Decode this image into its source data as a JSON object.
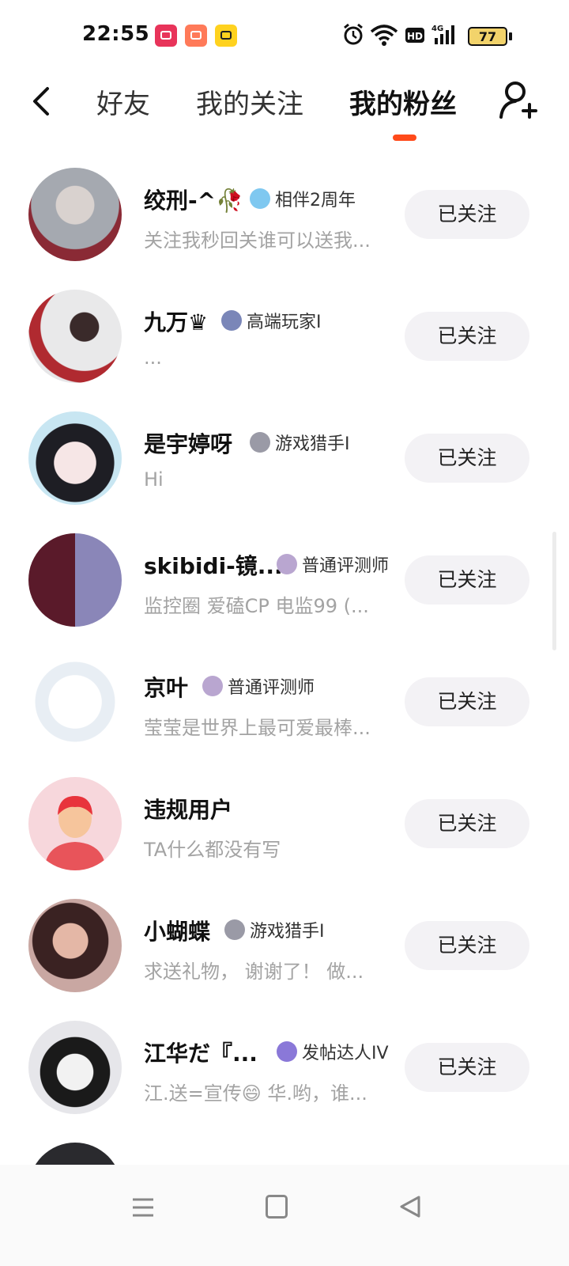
{
  "status_bar": {
    "time": "22:55",
    "battery_level": "77",
    "icons": [
      "video-app-icon",
      "game-app-icon",
      "tv-app-icon",
      "alarm-icon",
      "wifi-icon",
      "hd-icon",
      "4g-signal-icon",
      "battery-icon"
    ]
  },
  "nav": {
    "tabs": [
      {
        "label": "好友"
      },
      {
        "label": "我的关注"
      },
      {
        "label": "我的粉丝",
        "active": true
      }
    ],
    "accent_color": "#ff4a1a"
  },
  "fans": [
    {
      "name": "绞刑-^🥀",
      "badge": "相伴2周年",
      "badge_color": "#7fc8f0",
      "bio": "关注我秒回关谁可以送我...",
      "button": "已关注",
      "avatar_color": "#9aa0a8"
    },
    {
      "name": "九万♛",
      "badge": "高端玩家I",
      "badge_color": "#7a86b8",
      "bio": "...",
      "button": "已关注",
      "avatar_color": "#e2e2e4"
    },
    {
      "name": "是宇婷呀",
      "badge": "游戏猎手I",
      "badge_color": "#9a9aa6",
      "bio": "Hi",
      "button": "已关注",
      "avatar_color": "#c9e3f0"
    },
    {
      "name": "skibidi-镜...",
      "badge": "普通评测师",
      "badge_color": "#b9a6d0",
      "bio": "监控圈 爱磕CP 电监99 (...",
      "button": "已关注",
      "avatar_color": "#6b2a3a"
    },
    {
      "name": "京叶",
      "badge": "普通评测师",
      "badge_color": "#b9a6d0",
      "bio": "莹莹是世界上最可爱最棒...",
      "button": "已关注",
      "avatar_color": "#f4f4f6"
    },
    {
      "name": "违规用户",
      "badge": "",
      "badge_color": "",
      "bio": "TA什么都没有写",
      "button": "已关注",
      "avatar_color": "#f7d7dc"
    },
    {
      "name": "小蝴蝶",
      "badge": "游戏猎手I",
      "badge_color": "#9a9aa6",
      "bio": "求送礼物， 谢谢了！ 做...",
      "button": "已关注",
      "avatar_color": "#a86a6a"
    },
    {
      "name": "江华だ『...",
      "badge": "发帖达人IV",
      "badge_color": "#8a78d8",
      "bio": "江.送=宣传😄 华.哟，谁...",
      "button": "已关注",
      "avatar_color": "#d8d8dc"
    }
  ]
}
